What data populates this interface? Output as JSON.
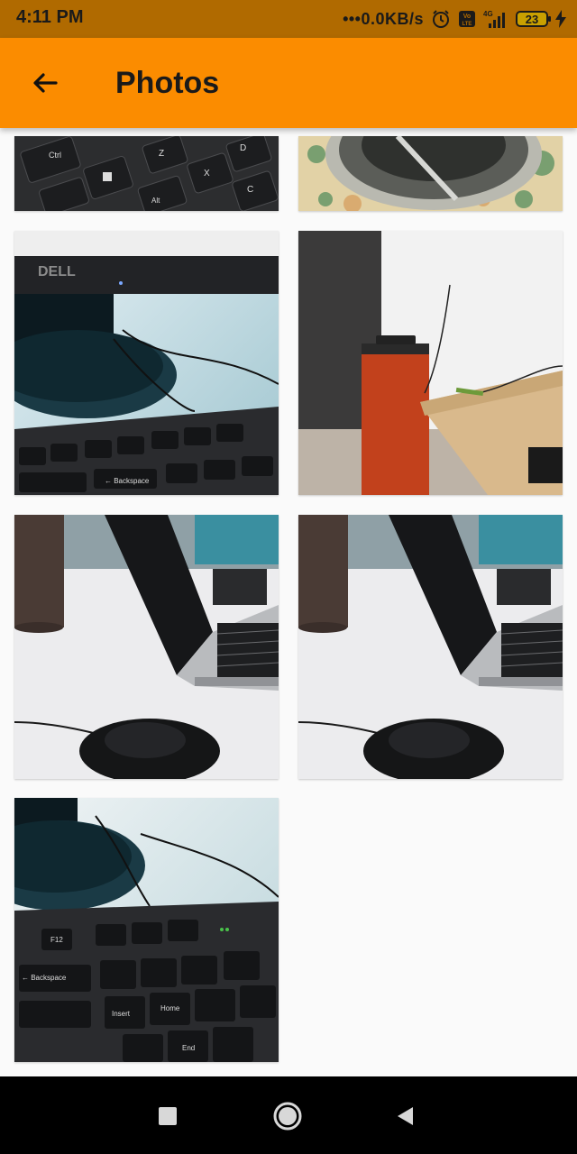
{
  "status_bar": {
    "time": "4:11 PM",
    "network_speed": "•••0.0KB/s",
    "battery_level": "23",
    "icons": [
      "alarm-icon",
      "volte-icon",
      "signal-4g-icon",
      "battery-icon",
      "charging-icon"
    ]
  },
  "app_bar": {
    "title": "Photos",
    "back_icon": "arrow-back-icon",
    "background_color": "#fb8c00"
  },
  "photos": [
    {
      "description_id": "keyboard-ctrl-win-alt-keys"
    },
    {
      "description_id": "glass-bowl-on-tablecloth"
    },
    {
      "description_id": "dell-monitor-and-keyboard"
    },
    {
      "description_id": "box-near-desk-wall"
    },
    {
      "description_id": "laptop-and-mouse-1"
    },
    {
      "description_id": "laptop-and-mouse-2"
    },
    {
      "description_id": "monitor-base-keyboard"
    }
  ],
  "nav_bar": {
    "icons": [
      "recents-square-icon",
      "home-circle-icon",
      "back-triangle-icon"
    ]
  }
}
